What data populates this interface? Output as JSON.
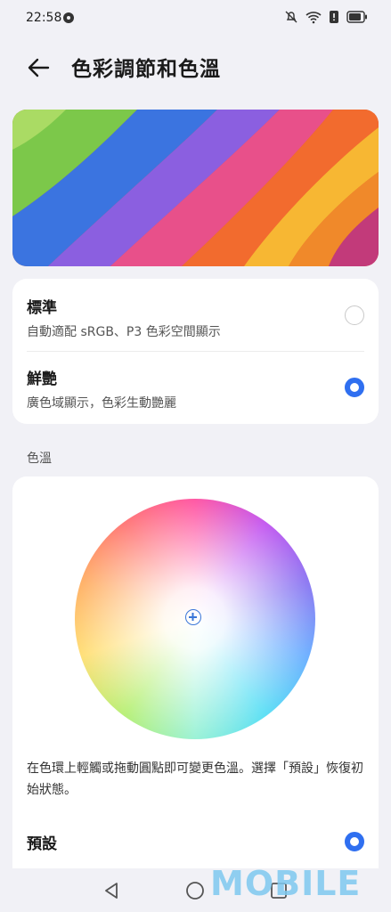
{
  "status": {
    "time": "22:58"
  },
  "header": {
    "title": "色彩調節和色溫"
  },
  "modes": [
    {
      "title": "標準",
      "subtitle": "自動適配 sRGB、P3 色彩空間顯示",
      "selected": false
    },
    {
      "title": "鮮艷",
      "subtitle": "廣色域顯示，色彩生動艷麗",
      "selected": true
    }
  ],
  "color_temp": {
    "section_label": "色溫",
    "help_text": "在色環上輕觸或拖動圓點即可變更色溫。選擇「預設」恢復初始狀態。",
    "preset_label": "預設",
    "preset_selected": true
  },
  "watermark": {
    "text": "MOBILE"
  },
  "colors": {
    "accent": "#2f6ff0",
    "background": "#f1f1f6",
    "card": "#ffffff"
  }
}
